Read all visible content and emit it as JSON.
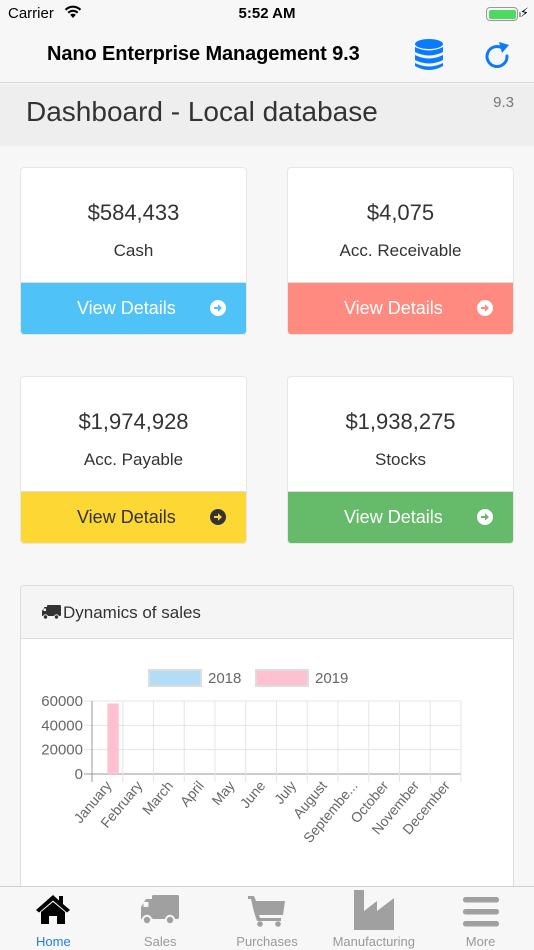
{
  "status_bar": {
    "carrier": "Carrier",
    "time": "5:52 AM",
    "battery_level": 1.0,
    "charging": true
  },
  "nav": {
    "title": "Nano Enterprise Management 9.3",
    "database_icon": "database-icon",
    "refresh_icon": "refresh-icon",
    "accent": "#0a7aff"
  },
  "page": {
    "title": "Dashboard - Local database",
    "version": "9.3"
  },
  "cards": [
    {
      "value": "$584,433",
      "label": "Cash",
      "button": "View Details",
      "color": "#4fc3f7",
      "text_color": "#ffffff"
    },
    {
      "value": "$4,075",
      "label": "Acc. Receivable",
      "button": "View Details",
      "color": "#ff8a80",
      "text_color": "#ffffff"
    },
    {
      "value": "$1,974,928",
      "label": "Acc. Payable",
      "button": "View Details",
      "color": "#fdd835",
      "text_color": "#333333"
    },
    {
      "value": "$1,938,275",
      "label": "Stocks",
      "button": "View Details",
      "color": "#66bb6a",
      "text_color": "#ffffff"
    }
  ],
  "panel": {
    "title": "Dynamics of sales",
    "icon": "truck-icon"
  },
  "chart_data": {
    "type": "bar",
    "title": "",
    "xlabel": "",
    "ylabel": "",
    "categories": [
      "January",
      "February",
      "March",
      "April",
      "May",
      "June",
      "July",
      "August",
      "Septembe...",
      "October",
      "November",
      "December"
    ],
    "series": [
      {
        "name": "2018",
        "color": "#b3dcf7",
        "border": "#9ccdf0",
        "values": [
          0,
          0,
          0,
          0,
          0,
          0,
          0,
          0,
          0,
          0,
          0,
          0
        ]
      },
      {
        "name": "2019",
        "color": "#ffc0cf",
        "border": "#f7a8ba",
        "values": [
          58000,
          0,
          0,
          0,
          0,
          0,
          0,
          0,
          0,
          0,
          0,
          0
        ]
      }
    ],
    "yticks": [
      0,
      20000,
      40000,
      60000
    ],
    "ylim": [
      0,
      60000
    ],
    "grid": true,
    "legend": "top"
  },
  "tabs": [
    {
      "label": "Home",
      "icon": "home-icon",
      "active": true
    },
    {
      "label": "Sales",
      "icon": "truck-icon",
      "active": false
    },
    {
      "label": "Purchases",
      "icon": "cart-icon",
      "active": false
    },
    {
      "label": "Manufacturing",
      "icon": "factory-icon",
      "active": false
    },
    {
      "label": "More",
      "icon": "menu-icon",
      "active": false
    }
  ]
}
